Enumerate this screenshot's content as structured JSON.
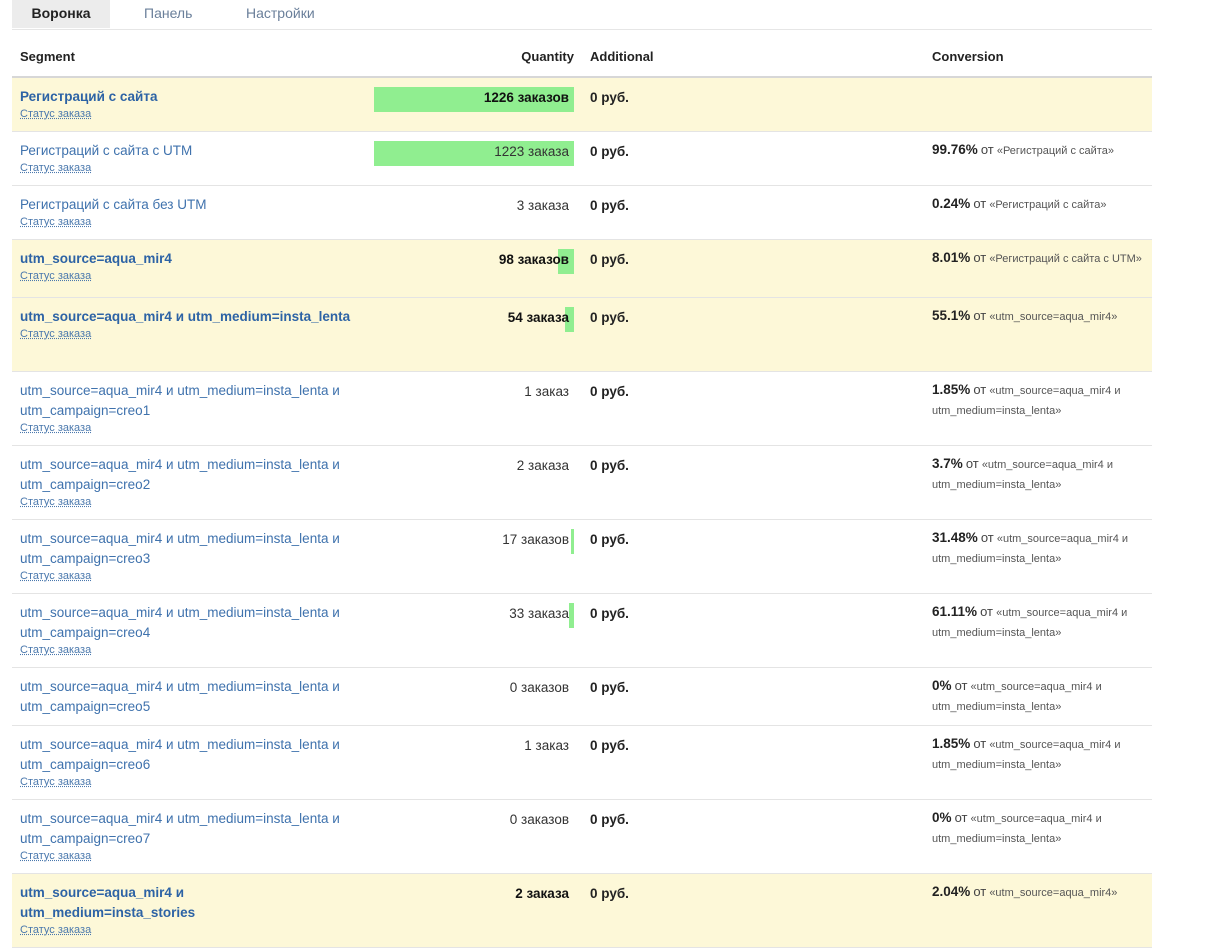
{
  "tabs": [
    {
      "label": "Воронка",
      "active": true
    },
    {
      "label": "Панель",
      "active": false
    },
    {
      "label": "Настройки",
      "active": false
    }
  ],
  "columns": {
    "segment": "Segment",
    "quantity": "Quantity",
    "additional": "Additional",
    "conversion": "Conversion"
  },
  "status_label": "Статус заказа",
  "from_label": "от",
  "bar_color": "#90ee90",
  "highlight_color": "#fdf8d8",
  "rows": [
    {
      "name": "Регистраций с сайта",
      "qty": "1226 заказов",
      "count": 1226,
      "additional": "0 руб.",
      "pct": "",
      "ref": "",
      "highlight": true,
      "status": true
    },
    {
      "name": "Регистраций с сайта с UTM",
      "qty": "1223 заказа",
      "count": 1223,
      "additional": "0 руб.",
      "pct": "99.76%",
      "ref": "«Регистраций с сайта»",
      "highlight": false,
      "status": true
    },
    {
      "name": "Регистраций с сайта без UTM",
      "qty": "3 заказа",
      "count": 3,
      "additional": "0 руб.",
      "pct": "0.24%",
      "ref": "«Регистраций с сайта»",
      "highlight": false,
      "status": true
    },
    {
      "name": "utm_source=aqua_mir4",
      "qty": "98 заказов",
      "count": 98,
      "additional": "0 руб.",
      "pct": "8.01%",
      "ref": "«Регистраций с сайта с UTM»",
      "highlight": true,
      "status": true
    },
    {
      "name": "utm_source=aqua_mir4 и utm_medium=insta_lenta",
      "qty": "54 заказа",
      "count": 54,
      "additional": "0 руб.",
      "pct": "55.1%",
      "ref": "«utm_source=aqua_mir4»",
      "highlight": true,
      "status": true
    },
    {
      "name": "utm_source=aqua_mir4 и utm_medium=insta_lenta и utm_campaign=creo1",
      "qty": "1 заказ",
      "count": 1,
      "additional": "0 руб.",
      "pct": "1.85%",
      "ref": "«utm_source=aqua_mir4 и utm_medium=insta_lenta»",
      "highlight": false,
      "status": true
    },
    {
      "name": "utm_source=aqua_mir4 и utm_medium=insta_lenta и utm_campaign=creo2",
      "qty": "2 заказа",
      "count": 2,
      "additional": "0 руб.",
      "pct": "3.7%",
      "ref": "«utm_source=aqua_mir4 и utm_medium=insta_lenta»",
      "highlight": false,
      "status": true
    },
    {
      "name": "utm_source=aqua_mir4 и utm_medium=insta_lenta и utm_campaign=creo3",
      "qty": "17 заказов",
      "count": 17,
      "additional": "0 руб.",
      "pct": "31.48%",
      "ref": "«utm_source=aqua_mir4 и utm_medium=insta_lenta»",
      "highlight": false,
      "status": true
    },
    {
      "name": "utm_source=aqua_mir4 и utm_medium=insta_lenta и utm_campaign=creo4",
      "qty": "33 заказа",
      "count": 33,
      "additional": "0 руб.",
      "pct": "61.11%",
      "ref": "«utm_source=aqua_mir4 и utm_medium=insta_lenta»",
      "highlight": false,
      "status": true
    },
    {
      "name": "utm_source=aqua_mir4 и utm_medium=insta_lenta и utm_campaign=creo5",
      "qty": "0 заказов",
      "count": 0,
      "additional": "0 руб.",
      "pct": "0%",
      "ref": "«utm_source=aqua_mir4 и utm_medium=insta_lenta»",
      "highlight": false,
      "status": false
    },
    {
      "name": "utm_source=aqua_mir4 и utm_medium=insta_lenta и utm_campaign=creo6",
      "qty": "1 заказ",
      "count": 1,
      "additional": "0 руб.",
      "pct": "1.85%",
      "ref": "«utm_source=aqua_mir4 и utm_medium=insta_lenta»",
      "highlight": false,
      "status": true
    },
    {
      "name": "utm_source=aqua_mir4 и utm_medium=insta_lenta и utm_campaign=creo7",
      "qty": "0 заказов",
      "count": 0,
      "additional": "0 руб.",
      "pct": "0%",
      "ref": "«utm_source=aqua_mir4 и utm_medium=insta_lenta»",
      "highlight": false,
      "status": true
    },
    {
      "name": "utm_source=aqua_mir4 и utm_medium=insta_stories",
      "qty": "2 заказа",
      "count": 2,
      "additional": "0 руб.",
      "pct": "2.04%",
      "ref": "«utm_source=aqua_mir4»",
      "highlight": true,
      "status": true
    }
  ]
}
